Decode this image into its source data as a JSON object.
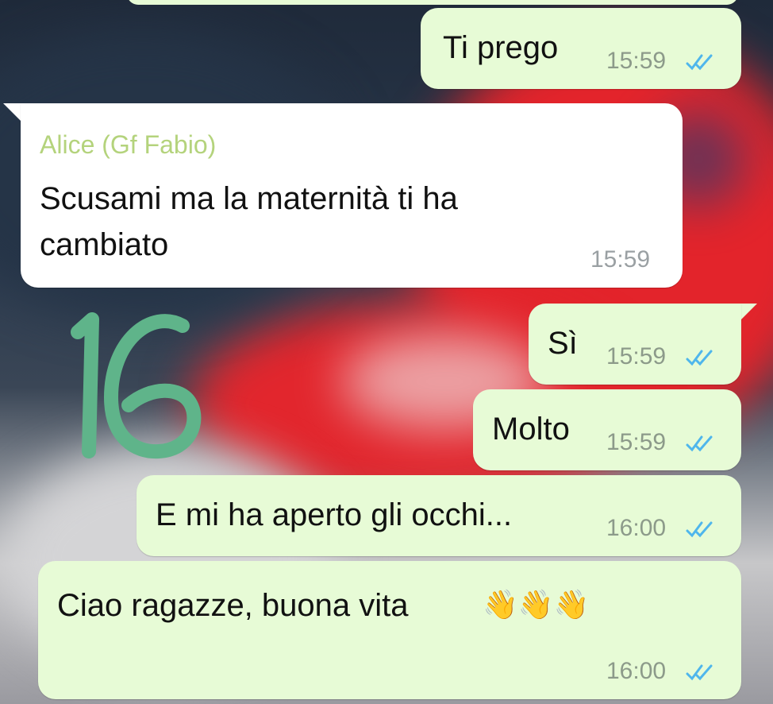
{
  "messages": [
    {
      "id": "m1",
      "direction": "outgoing",
      "text": "Ti prego",
      "time": "15:59",
      "status": "read"
    },
    {
      "id": "m2",
      "direction": "incoming",
      "sender": "Alice (Gf Fabio)",
      "text_line1": "Scusami ma la maternità ti ha",
      "text_line2": "cambiato",
      "time": "15:59"
    },
    {
      "id": "m3",
      "direction": "outgoing",
      "text": "Sì",
      "time": "15:59",
      "status": "read"
    },
    {
      "id": "m4",
      "direction": "outgoing",
      "text": "Molto",
      "time": "15:59",
      "status": "read"
    },
    {
      "id": "m5",
      "direction": "outgoing",
      "text": "E mi ha aperto gli occhi...",
      "time": "16:00",
      "status": "read"
    },
    {
      "id": "m6",
      "direction": "outgoing",
      "text": "Ciao ragazze, buona vita",
      "emoji": "👋👋👋",
      "time": "16:00",
      "status": "read"
    }
  ],
  "overlay": {
    "handwritten_number": "16"
  },
  "colors": {
    "outgoing_bubble": "#e7fbd6",
    "incoming_bubble": "#ffffff",
    "sender_name": "#b4d37c",
    "read_ticks": "#4fb6ec",
    "handwriting": "#5fb48a"
  },
  "icons": {
    "read_status": "double-check-icon",
    "emoji": "waving-hand-emoji"
  }
}
